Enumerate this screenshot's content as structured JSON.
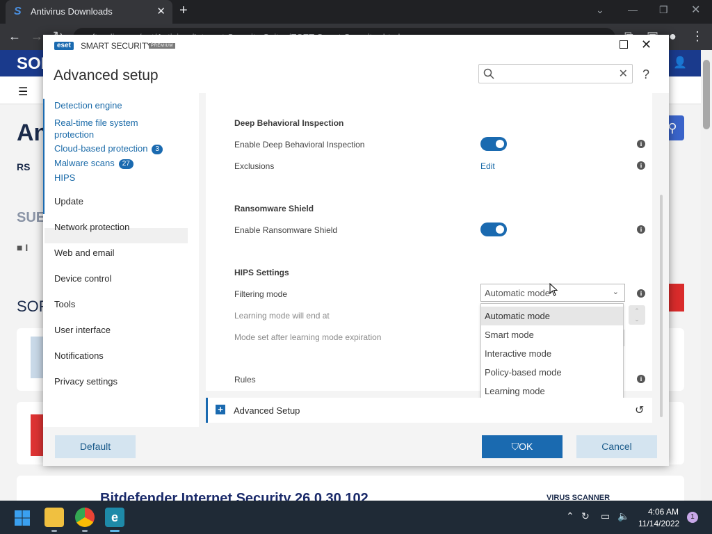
{
  "browser": {
    "tab_title": "Antivirus Downloads",
    "url": "softpedia.com/get/Antivirus/Internet-Security-Suites/ESET-Smart-Security.shtml"
  },
  "website": {
    "logo": "SOF",
    "heading": "An",
    "rss": "RS",
    "sub": "SUE",
    "folder": "I",
    "sor": "SOR",
    "bottom_title": "Bitdefender Internet Security 26.0.30.102",
    "bottom_tag": "VIRUS SCANNER"
  },
  "eset": {
    "logo": "eset",
    "brand": "SMART SECURITY",
    "badge": "PREMIUM",
    "title": "Advanced setup",
    "help": "?",
    "sidebar": [
      {
        "label": "Detection engine",
        "sub": true
      },
      {
        "label": "Real-time file system protection",
        "sub": true
      },
      {
        "label": "Cloud-based protection",
        "sub": true,
        "badge": "3"
      },
      {
        "label": "Malware scans",
        "sub": true,
        "badge": "27"
      },
      {
        "label": "HIPS",
        "sub": true
      },
      {
        "label": "Update"
      },
      {
        "label": "Network protection"
      },
      {
        "label": "Web and email"
      },
      {
        "label": "Device control"
      },
      {
        "label": "Tools"
      },
      {
        "label": "User interface"
      },
      {
        "label": "Notifications"
      },
      {
        "label": "Privacy settings"
      }
    ],
    "sections": {
      "dbi": {
        "title": "Deep Behavioral Inspection",
        "enable_label": "Enable Deep Behavioral Inspection",
        "enable_value": true,
        "exclusions_label": "Exclusions",
        "exclusions_link": "Edit"
      },
      "ransomware": {
        "title": "Ransomware Shield",
        "enable_label": "Enable Ransomware Shield",
        "enable_value": true
      },
      "hips": {
        "title": "HIPS Settings",
        "filtering_label": "Filtering mode",
        "filtering_value": "Automatic mode",
        "learning_end_label": "Learning mode will end at",
        "after_learning_label": "Mode set after learning mode expiration",
        "rules_label": "Rules"
      }
    },
    "dropdown_options": [
      "Automatic mode",
      "Smart mode",
      "Interactive mode",
      "Policy-based mode",
      "Learning mode"
    ],
    "advanced_bar": "Advanced Setup",
    "buttons": {
      "default": "Default",
      "ok": "OK",
      "cancel": "Cancel"
    }
  },
  "taskbar": {
    "time": "4:06 AM",
    "date": "11/14/2022",
    "notifications": "1"
  },
  "colors": {
    "accent": "#1a6ab0",
    "site_header": "#1a3a8c"
  }
}
